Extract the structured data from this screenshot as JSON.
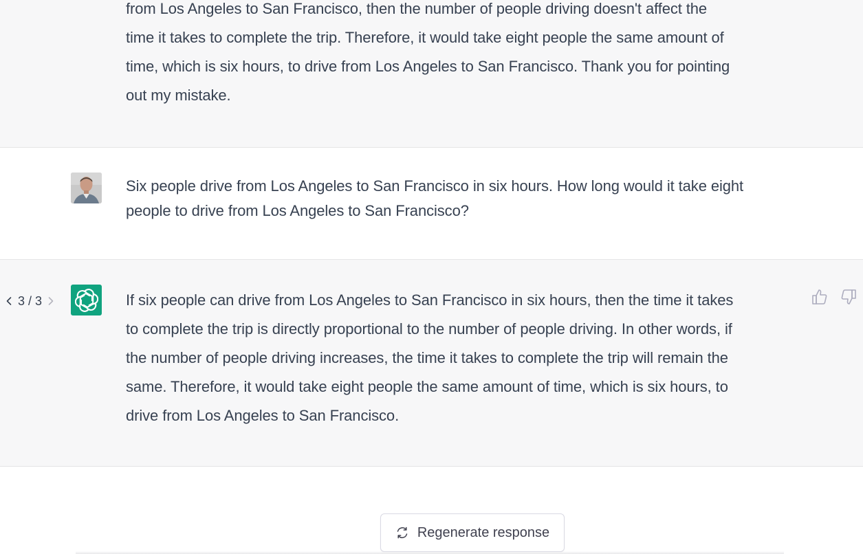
{
  "conversation": {
    "prev_assistant": {
      "lines": [
        "from Los Angeles to San Francisco, then the number of people driving doesn't affect the",
        "time it takes to complete the trip. Therefore, it would take eight people the same amount of",
        "time, which is six hours, to drive from Los Angeles to San Francisco. Thank you for pointing",
        "out my mistake."
      ]
    },
    "user_message": {
      "lines": [
        "Six people drive from Los Angeles to San Francisco in six hours. How long would it take eight",
        "people to drive from Los Angeles to San Francisco?"
      ]
    },
    "assistant_message": {
      "pager_text": "3 / 3",
      "lines": [
        "If six people can drive from Los Angeles to San Francisco in six hours, then the time it takes",
        "to complete the trip is directly proportional to the number of people driving. In other words, if",
        "the number of people driving increases, the time it takes to complete the trip will remain the",
        "same. Therefore, it would take eight people the same amount of time, which is six hours, to",
        "drive from Los Angeles to San Francisco."
      ]
    }
  },
  "actions": {
    "regenerate_label": "Regenerate response"
  },
  "icons": {
    "prev": "chevron-left-icon",
    "next": "chevron-right-icon",
    "thumbs_up": "thumbs-up-icon",
    "thumbs_down": "thumbs-down-icon",
    "regenerate": "refresh-icon",
    "assistant_avatar": "openai-logo-icon"
  },
  "colors": {
    "assistant_bg": "#f7f7f8",
    "brand_green": "#10a37f",
    "text": "#374151"
  }
}
